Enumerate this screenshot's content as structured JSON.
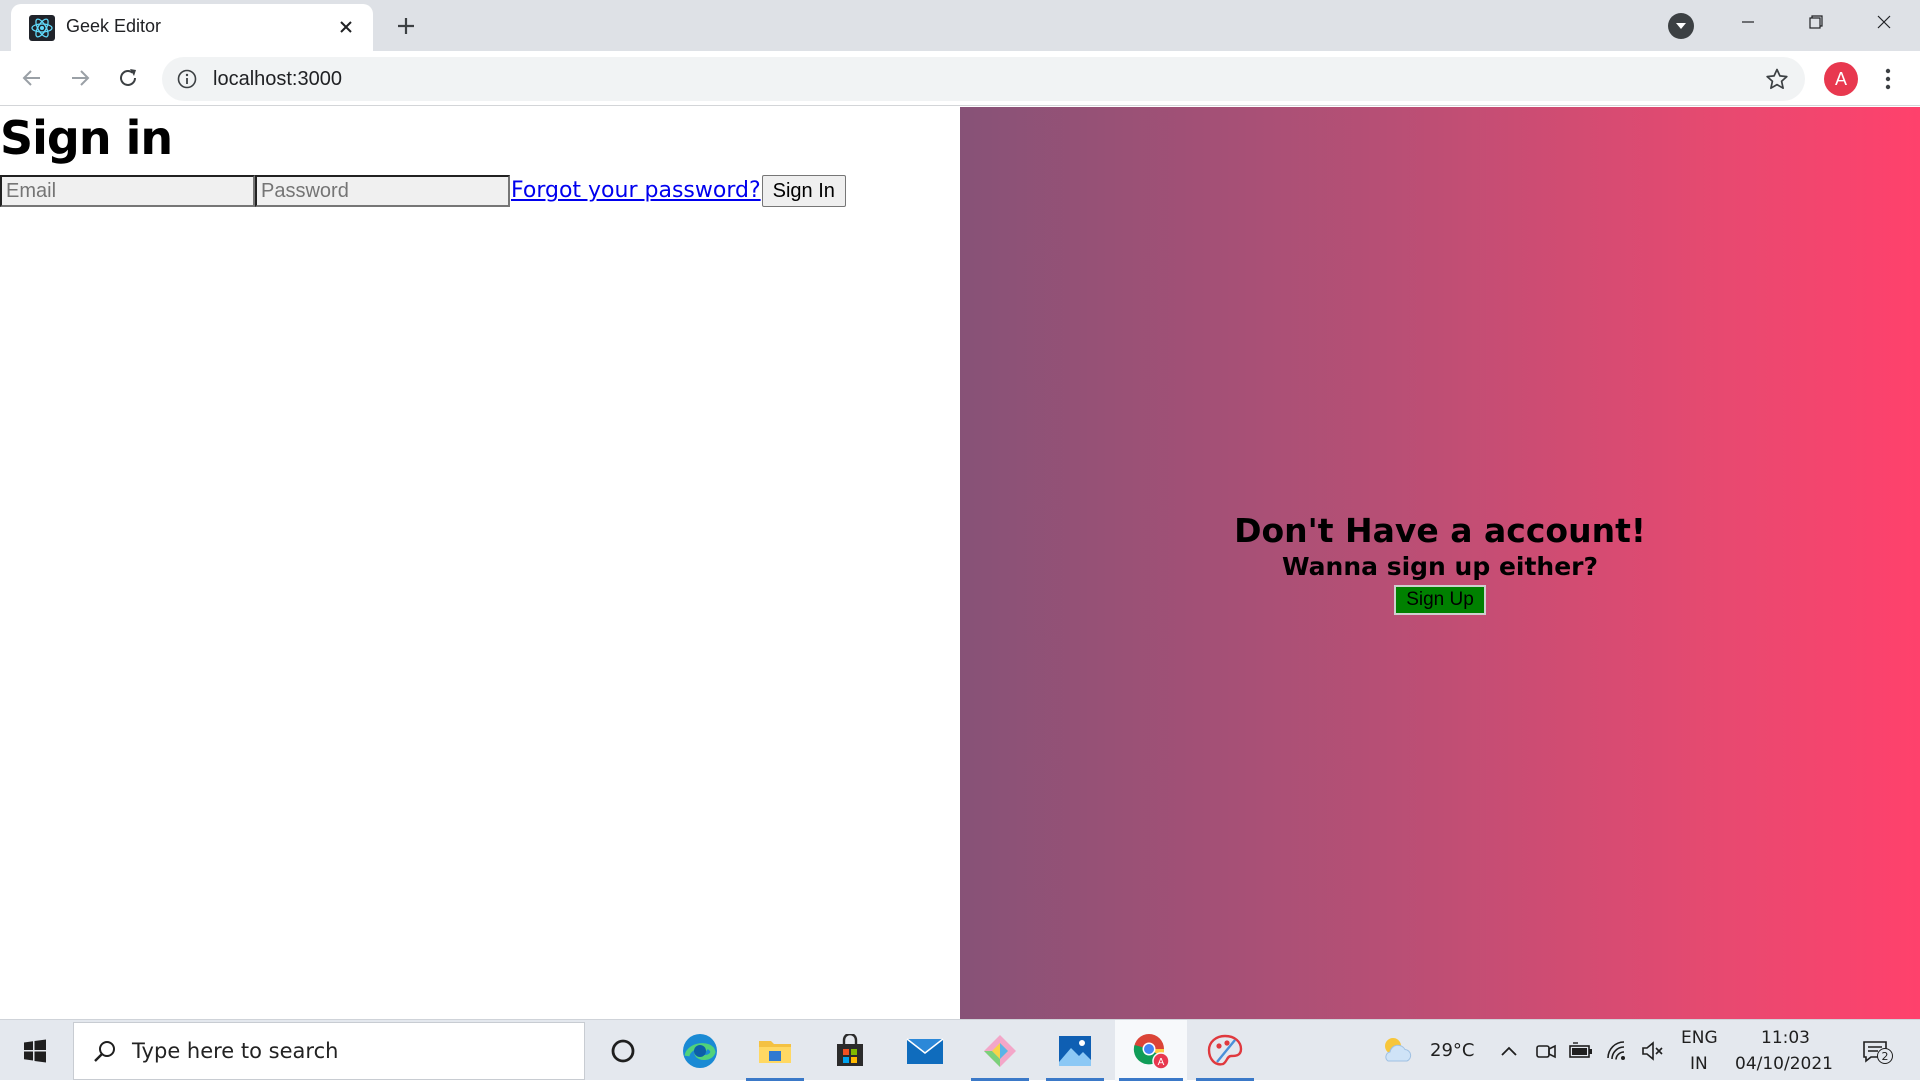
{
  "browser": {
    "tab": {
      "title": "Geek Editor",
      "favicon": "react-atom-icon"
    },
    "address": {
      "url": "localhost:3000"
    },
    "profile_initial": "A"
  },
  "page": {
    "signin": {
      "title": "Sign in",
      "email_placeholder": "Email",
      "password_placeholder": "Password",
      "forgot_link": "Forgot your password?",
      "submit_label": "Sign In"
    },
    "signup_panel": {
      "title": "Don't Have a account!",
      "subtitle": "Wanna sign up either?",
      "button_label": "Sign Up"
    }
  },
  "taskbar": {
    "search_placeholder": "Type here to search",
    "apps": [
      "cortana-icon",
      "edge-icon",
      "file-explorer-icon",
      "store-icon",
      "mail-icon",
      "snip-sketch-icon",
      "photos-icon",
      "chrome-icon",
      "paint-icon"
    ],
    "weather": {
      "temp": "29°C",
      "icon": "partly-cloudy-icon"
    },
    "language": {
      "line1": "ENG",
      "line2": "IN"
    },
    "clock": {
      "time": "11:03",
      "date": "04/10/2021"
    },
    "notifications": {
      "count": "2"
    }
  },
  "colors": {
    "panel_gradient_start": "#875277",
    "panel_gradient_end": "#ff416c",
    "signup_button": "#008000",
    "link": "#0000ee"
  }
}
